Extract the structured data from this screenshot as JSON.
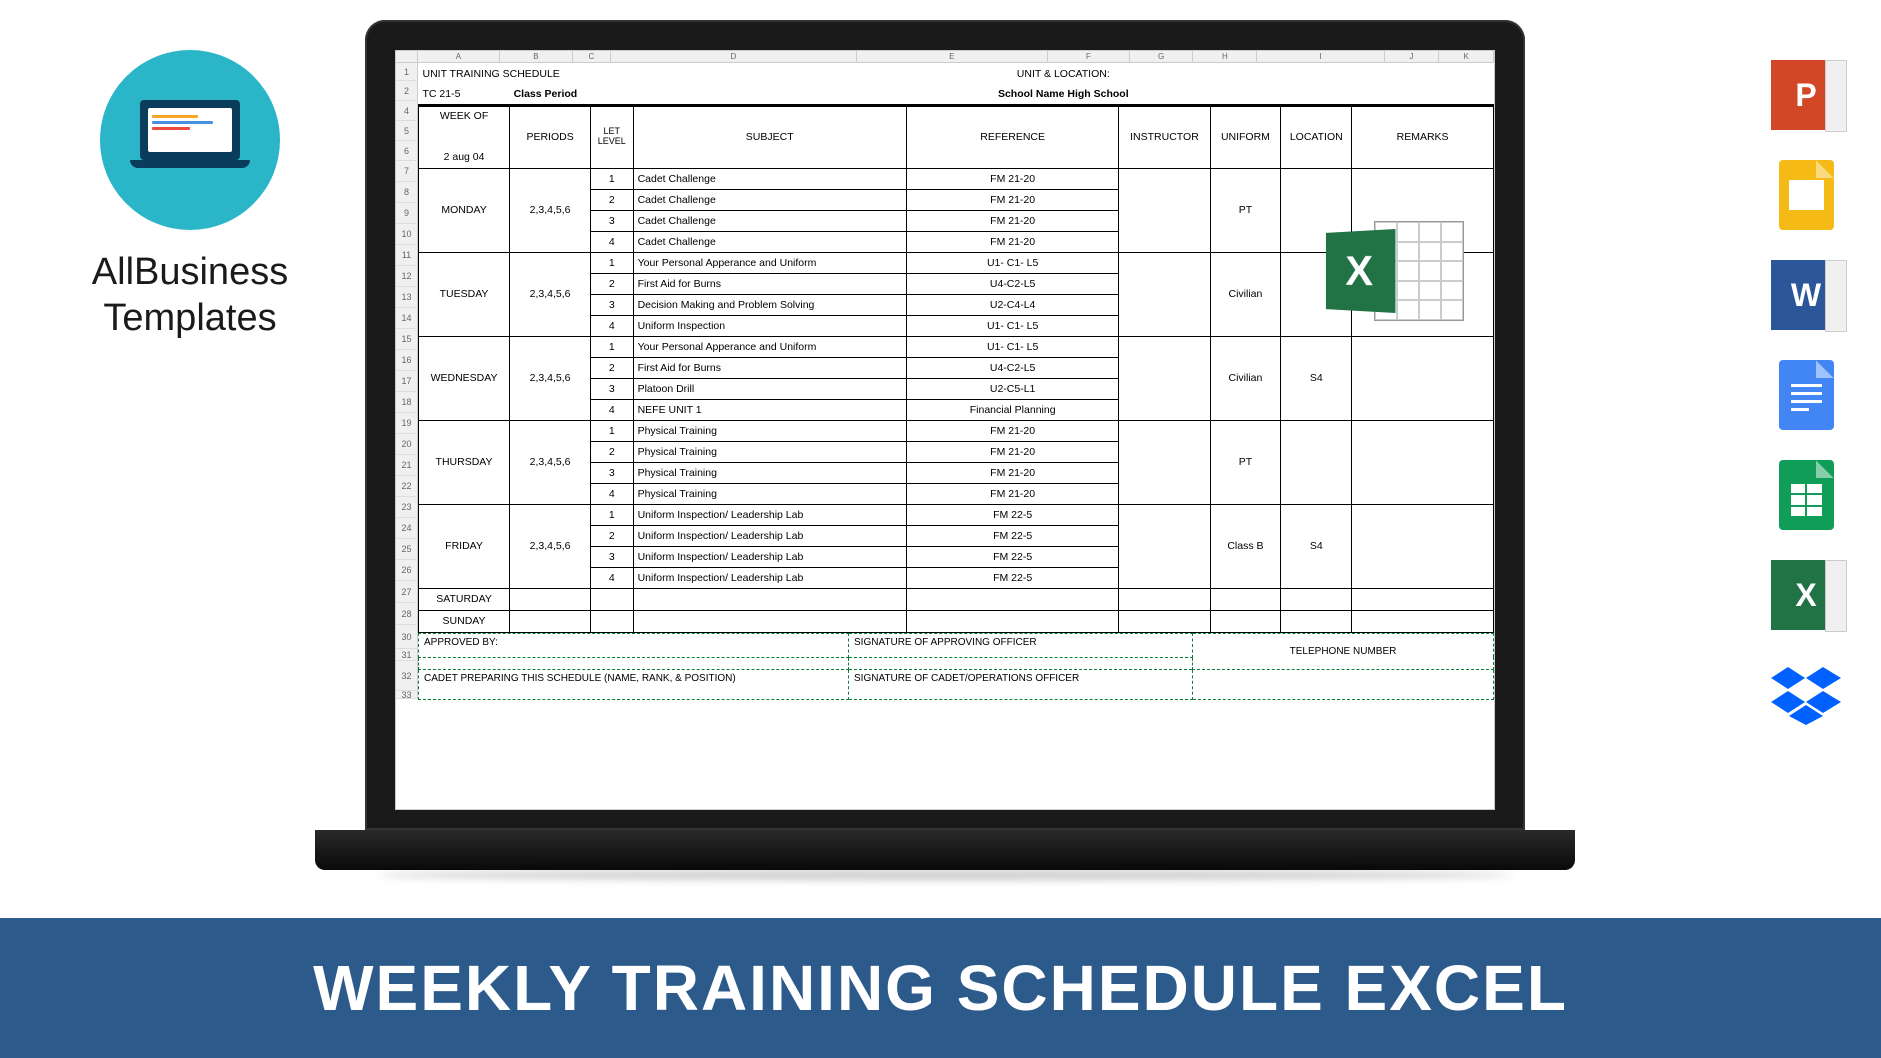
{
  "logo": {
    "line1": "AllBusiness",
    "line2": "Templates"
  },
  "banner": "WEEKLY TRAINING SCHEDULE EXCEL",
  "spreadsheet": {
    "columns": [
      "A",
      "B",
      "C",
      "D",
      "E",
      "F",
      "G",
      "H",
      "I",
      "J",
      "K"
    ],
    "row_numbers": [
      "1",
      "2",
      "4",
      "5",
      "6",
      "7",
      "8",
      "9",
      "10",
      "11",
      "12",
      "13",
      "14",
      "15",
      "16",
      "17",
      "18",
      "19",
      "20",
      "21",
      "22",
      "23",
      "24",
      "25",
      "26",
      "27",
      "28",
      "30",
      "31",
      "32",
      "33"
    ],
    "title": "UNIT TRAINING SCHEDULE",
    "unit_label": "UNIT & LOCATION:",
    "tc": "TC 21-5",
    "class_period": "Class Period",
    "school": "School Name High School",
    "headers": {
      "week_of": "WEEK OF",
      "week_of_date": "2 aug 04",
      "periods": "PERIODS",
      "let_level": "LET LEVEL",
      "subject": "SUBJECT",
      "reference": "REFERENCE",
      "instructor": "INSTRUCTOR",
      "uniform": "UNIFORM",
      "location": "LOCATION",
      "remarks": "REMARKS"
    },
    "days": [
      {
        "name": "MONDAY",
        "periods": "2,3,4,5,6",
        "uniform": "PT",
        "location": "",
        "rows": [
          {
            "let": "1",
            "subject": "Cadet Challenge",
            "ref": "FM 21-20"
          },
          {
            "let": "2",
            "subject": "Cadet Challenge",
            "ref": "FM 21-20"
          },
          {
            "let": "3",
            "subject": "Cadet Challenge",
            "ref": "FM 21-20"
          },
          {
            "let": "4",
            "subject": "Cadet Challenge",
            "ref": "FM 21-20"
          }
        ]
      },
      {
        "name": "TUESDAY",
        "periods": "2,3,4,5,6",
        "uniform": "Civilian",
        "location": "",
        "rows": [
          {
            "let": "1",
            "subject": "Your Personal Apperance and Uniform",
            "ref": "U1- C1- L5"
          },
          {
            "let": "2",
            "subject": "First Aid for Burns",
            "ref": "U4-C2-L5"
          },
          {
            "let": "3",
            "subject": "Decision Making and Problem Solving",
            "ref": "U2-C4-L4"
          },
          {
            "let": "4",
            "subject": "Uniform Inspection",
            "ref": "U1- C1- L5"
          }
        ]
      },
      {
        "name": "WEDNESDAY",
        "periods": "2,3,4,5,6",
        "uniform": "Civilian",
        "location": "S4",
        "rows": [
          {
            "let": "1",
            "subject": "Your Personal Apperance and Uniform",
            "ref": "U1- C1- L5"
          },
          {
            "let": "2",
            "subject": "First Aid for Burns",
            "ref": "U4-C2-L5"
          },
          {
            "let": "3",
            "subject": "Platoon Drill",
            "ref": "U2-C5-L1"
          },
          {
            "let": "4",
            "subject": "NEFE UNIT 1",
            "ref": "Financial Planning"
          }
        ]
      },
      {
        "name": "THURSDAY",
        "periods": "2,3,4,5,6",
        "uniform": "PT",
        "location": "",
        "rows": [
          {
            "let": "1",
            "subject": "Physical Training",
            "ref": "FM 21-20"
          },
          {
            "let": "2",
            "subject": "Physical Training",
            "ref": "FM 21-20"
          },
          {
            "let": "3",
            "subject": "Physical Training",
            "ref": "FM 21-20"
          },
          {
            "let": "4",
            "subject": "Physical Training",
            "ref": "FM 21-20"
          }
        ]
      },
      {
        "name": "FRIDAY",
        "periods": "2,3,4,5,6",
        "uniform": "Class B",
        "location": "S4",
        "rows": [
          {
            "let": "1",
            "subject": "Uniform Inspection/ Leadership Lab",
            "ref": "FM 22-5"
          },
          {
            "let": "2",
            "subject": "Uniform Inspection/ Leadership Lab",
            "ref": "FM 22-5"
          },
          {
            "let": "3",
            "subject": "Uniform Inspection/ Leadership Lab",
            "ref": "FM 22-5"
          },
          {
            "let": "4",
            "subject": "Uniform Inspection/ Leadership Lab",
            "ref": "FM 22-5"
          }
        ]
      }
    ],
    "weekend": [
      "SATURDAY",
      "SUNDAY"
    ],
    "footer": {
      "approved": "APPROVED BY:",
      "sig1": "SIGNATURE OF APPROVING OFFICER",
      "cadet": "CADET PREPARING THIS SCHEDULE (NAME, RANK, & POSITION)",
      "sig2": "SIGNATURE OF CADET/OPERATIONS OFFICER",
      "phone": "TELEPHONE NUMBER"
    }
  },
  "app_icons": {
    "ppt": "P",
    "word": "W",
    "excel": "X"
  }
}
